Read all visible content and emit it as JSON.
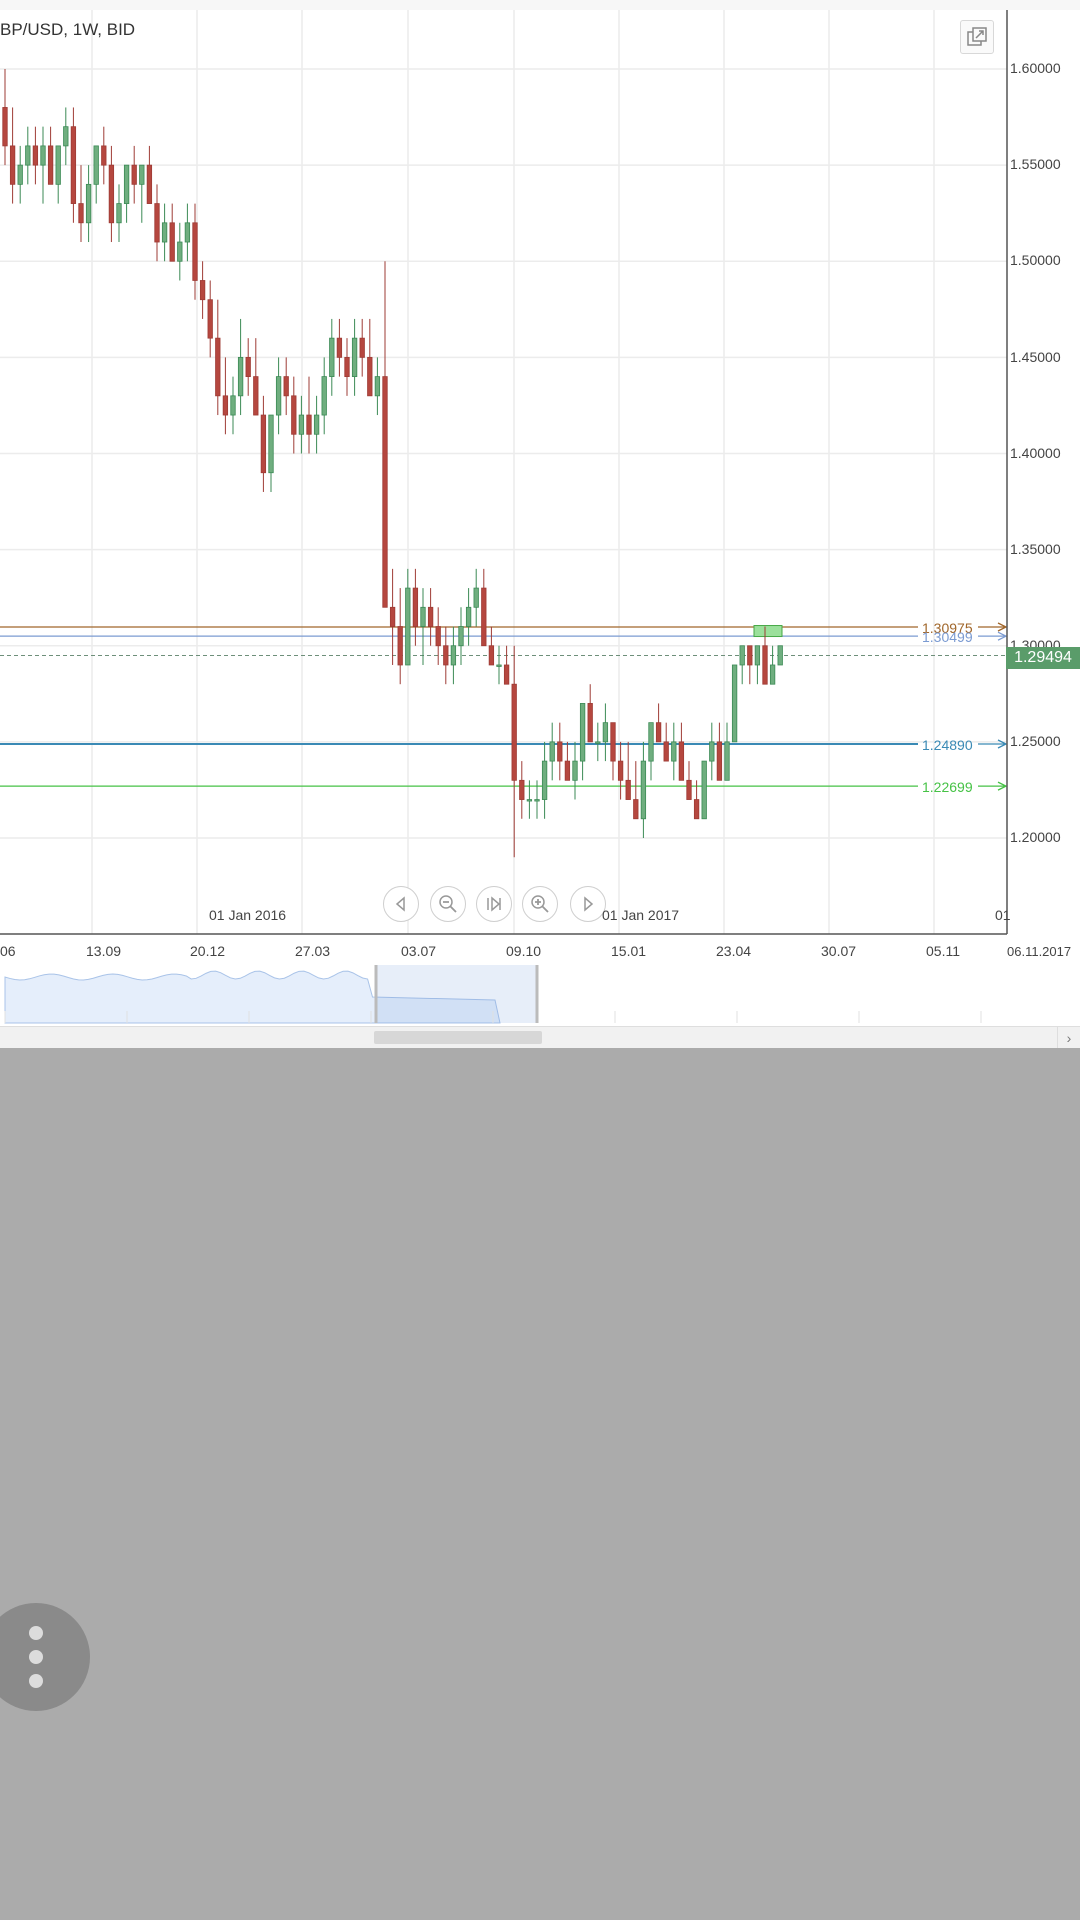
{
  "header": {
    "title": "BP/USD, 1W, BID",
    "expand_icon": "popout-icon"
  },
  "price_tag": "1.29494",
  "horizontal_lines": [
    {
      "label": "1.30975",
      "color": "#a0662a"
    },
    {
      "label": "1.30499",
      "color": "#7b9bd2"
    },
    {
      "label": "1.24890",
      "color": "#3a8ab5"
    },
    {
      "label": "1.22699",
      "color": "#46c246"
    }
  ],
  "navigation": {
    "prev_icon": "arrow-left-icon",
    "zoom_out_icon": "zoom-out-icon",
    "skip_end_icon": "skip-end-icon",
    "zoom_in_icon": "zoom-in-icon",
    "next_icon": "arrow-right-icon"
  },
  "chart_data": {
    "type": "candlestick",
    "ylim": [
      1.16,
      1.62
    ],
    "y_ticks": [
      "1.60000",
      "1.55000",
      "1.50000",
      "1.45000",
      "1.40000",
      "1.35000",
      "1.30000",
      "1.25000",
      "1.20000"
    ],
    "x_ticks": [
      "06",
      "13.09",
      "20.12",
      "27.03",
      "03.07",
      "09.10",
      "15.01",
      "23.04",
      "30.07",
      "05.11",
      "06.11.2017"
    ],
    "year_labels": [
      "01 Jan 2016",
      "01 Jan 2017",
      "01"
    ],
    "grid": true,
    "candles": [
      [
        1.58,
        1.6,
        1.55,
        1.56
      ],
      [
        1.56,
        1.58,
        1.53,
        1.54
      ],
      [
        1.54,
        1.56,
        1.53,
        1.55
      ],
      [
        1.55,
        1.57,
        1.54,
        1.56
      ],
      [
        1.56,
        1.57,
        1.54,
        1.55
      ],
      [
        1.55,
        1.57,
        1.53,
        1.56
      ],
      [
        1.56,
        1.57,
        1.54,
        1.54
      ],
      [
        1.54,
        1.56,
        1.53,
        1.56
      ],
      [
        1.56,
        1.58,
        1.55,
        1.57
      ],
      [
        1.57,
        1.58,
        1.52,
        1.53
      ],
      [
        1.53,
        1.55,
        1.51,
        1.52
      ],
      [
        1.52,
        1.55,
        1.51,
        1.54
      ],
      [
        1.54,
        1.56,
        1.53,
        1.56
      ],
      [
        1.56,
        1.57,
        1.54,
        1.55
      ],
      [
        1.55,
        1.56,
        1.51,
        1.52
      ],
      [
        1.52,
        1.54,
        1.51,
        1.53
      ],
      [
        1.53,
        1.55,
        1.52,
        1.55
      ],
      [
        1.55,
        1.56,
        1.53,
        1.54
      ],
      [
        1.54,
        1.55,
        1.52,
        1.55
      ],
      [
        1.55,
        1.56,
        1.53,
        1.53
      ],
      [
        1.53,
        1.54,
        1.5,
        1.51
      ],
      [
        1.51,
        1.53,
        1.5,
        1.52
      ],
      [
        1.52,
        1.53,
        1.5,
        1.5
      ],
      [
        1.5,
        1.52,
        1.49,
        1.51
      ],
      [
        1.51,
        1.53,
        1.5,
        1.52
      ],
      [
        1.52,
        1.53,
        1.48,
        1.49
      ],
      [
        1.49,
        1.5,
        1.47,
        1.48
      ],
      [
        1.48,
        1.49,
        1.45,
        1.46
      ],
      [
        1.46,
        1.48,
        1.42,
        1.43
      ],
      [
        1.43,
        1.45,
        1.41,
        1.42
      ],
      [
        1.42,
        1.44,
        1.41,
        1.43
      ],
      [
        1.43,
        1.47,
        1.42,
        1.45
      ],
      [
        1.45,
        1.46,
        1.43,
        1.44
      ],
      [
        1.44,
        1.46,
        1.42,
        1.42
      ],
      [
        1.42,
        1.43,
        1.38,
        1.39
      ],
      [
        1.39,
        1.42,
        1.38,
        1.42
      ],
      [
        1.42,
        1.45,
        1.41,
        1.44
      ],
      [
        1.44,
        1.45,
        1.42,
        1.43
      ],
      [
        1.43,
        1.44,
        1.4,
        1.41
      ],
      [
        1.41,
        1.43,
        1.4,
        1.42
      ],
      [
        1.42,
        1.44,
        1.4,
        1.41
      ],
      [
        1.41,
        1.43,
        1.4,
        1.42
      ],
      [
        1.42,
        1.45,
        1.41,
        1.44
      ],
      [
        1.44,
        1.47,
        1.43,
        1.46
      ],
      [
        1.46,
        1.47,
        1.44,
        1.45
      ],
      [
        1.45,
        1.46,
        1.43,
        1.44
      ],
      [
        1.44,
        1.47,
        1.43,
        1.46
      ],
      [
        1.46,
        1.47,
        1.44,
        1.45
      ],
      [
        1.45,
        1.47,
        1.43,
        1.43
      ],
      [
        1.43,
        1.45,
        1.42,
        1.44
      ],
      [
        1.44,
        1.5,
        1.33,
        1.32
      ],
      [
        1.32,
        1.34,
        1.29,
        1.31
      ],
      [
        1.31,
        1.33,
        1.28,
        1.29
      ],
      [
        1.29,
        1.34,
        1.29,
        1.33
      ],
      [
        1.33,
        1.34,
        1.3,
        1.31
      ],
      [
        1.31,
        1.33,
        1.29,
        1.32
      ],
      [
        1.32,
        1.33,
        1.3,
        1.31
      ],
      [
        1.31,
        1.32,
        1.29,
        1.3
      ],
      [
        1.3,
        1.31,
        1.28,
        1.29
      ],
      [
        1.29,
        1.31,
        1.28,
        1.3
      ],
      [
        1.3,
        1.32,
        1.29,
        1.31
      ],
      [
        1.31,
        1.33,
        1.3,
        1.32
      ],
      [
        1.32,
        1.34,
        1.31,
        1.33
      ],
      [
        1.33,
        1.34,
        1.3,
        1.3
      ],
      [
        1.3,
        1.31,
        1.29,
        1.29
      ],
      [
        1.29,
        1.3,
        1.28,
        1.29
      ],
      [
        1.29,
        1.3,
        1.28,
        1.28
      ],
      [
        1.28,
        1.3,
        1.19,
        1.23
      ],
      [
        1.23,
        1.24,
        1.21,
        1.22
      ],
      [
        1.22,
        1.23,
        1.21,
        1.22
      ],
      [
        1.22,
        1.23,
        1.21,
        1.22
      ],
      [
        1.22,
        1.25,
        1.21,
        1.24
      ],
      [
        1.24,
        1.26,
        1.23,
        1.25
      ],
      [
        1.25,
        1.26,
        1.23,
        1.24
      ],
      [
        1.24,
        1.25,
        1.23,
        1.23
      ],
      [
        1.23,
        1.25,
        1.22,
        1.24
      ],
      [
        1.24,
        1.27,
        1.23,
        1.27
      ],
      [
        1.27,
        1.28,
        1.25,
        1.25
      ],
      [
        1.25,
        1.26,
        1.24,
        1.25
      ],
      [
        1.25,
        1.27,
        1.24,
        1.26
      ],
      [
        1.26,
        1.26,
        1.23,
        1.24
      ],
      [
        1.24,
        1.25,
        1.22,
        1.23
      ],
      [
        1.23,
        1.25,
        1.22,
        1.22
      ],
      [
        1.22,
        1.24,
        1.21,
        1.21
      ],
      [
        1.21,
        1.25,
        1.2,
        1.24
      ],
      [
        1.24,
        1.26,
        1.23,
        1.26
      ],
      [
        1.26,
        1.27,
        1.25,
        1.25
      ],
      [
        1.25,
        1.26,
        1.24,
        1.24
      ],
      [
        1.24,
        1.26,
        1.23,
        1.25
      ],
      [
        1.25,
        1.26,
        1.23,
        1.23
      ],
      [
        1.23,
        1.24,
        1.22,
        1.22
      ],
      [
        1.22,
        1.23,
        1.21,
        1.21
      ],
      [
        1.21,
        1.24,
        1.21,
        1.24
      ],
      [
        1.24,
        1.26,
        1.23,
        1.25
      ],
      [
        1.25,
        1.26,
        1.23,
        1.23
      ],
      [
        1.23,
        1.26,
        1.23,
        1.25
      ],
      [
        1.25,
        1.29,
        1.25,
        1.29
      ],
      [
        1.29,
        1.3,
        1.28,
        1.3
      ],
      [
        1.3,
        1.3,
        1.28,
        1.29
      ],
      [
        1.29,
        1.3,
        1.28,
        1.3
      ],
      [
        1.3,
        1.31,
        1.28,
        1.28
      ],
      [
        1.28,
        1.3,
        1.28,
        1.29
      ],
      [
        1.29,
        1.3,
        1.29,
        1.3
      ]
    ]
  }
}
